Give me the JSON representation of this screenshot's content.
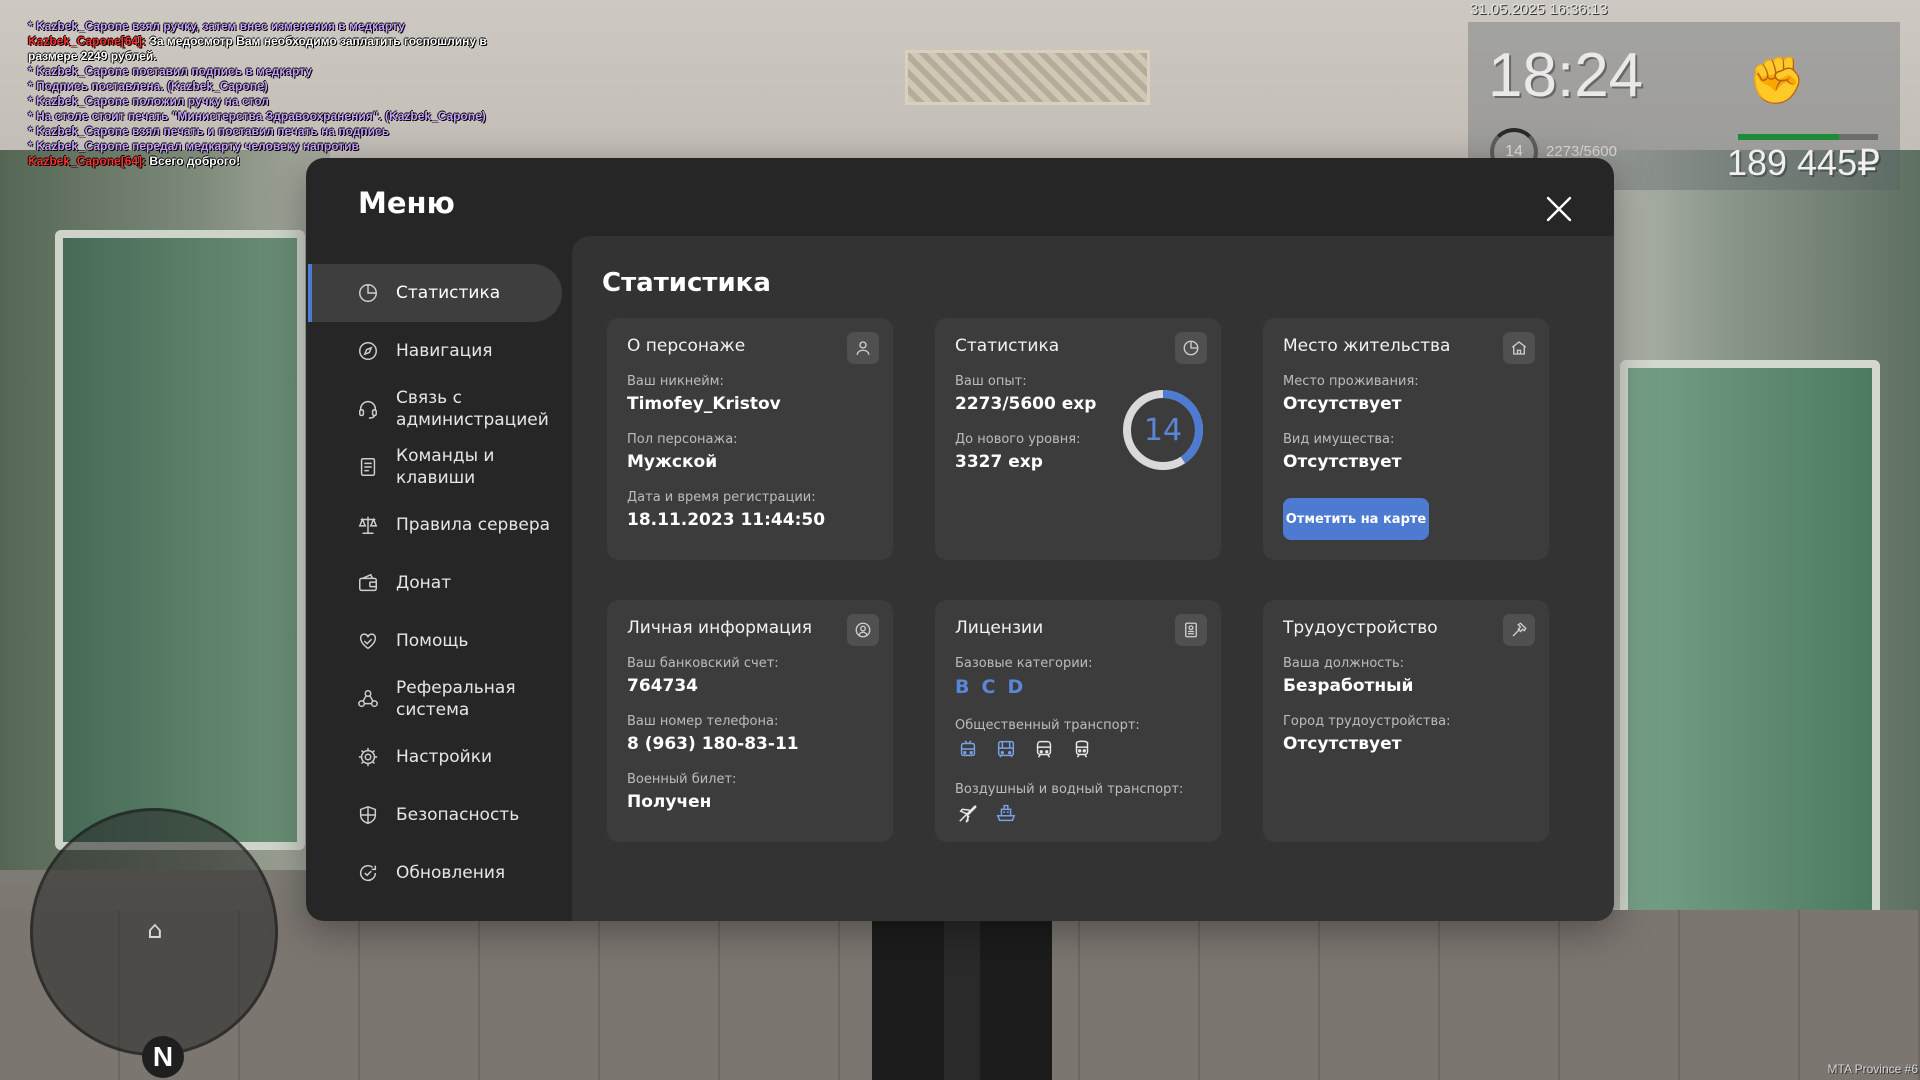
{
  "chat": [
    {
      "type": "me",
      "text": "* Kazbek_Capone взял ручку, затем внес изменения в медкарту"
    },
    {
      "type": "say",
      "nick": "Kazbek_Capone[64]:",
      "text": "За медосмотр Вам необходимо заплатить госпошлину в размере 2249 рублей."
    },
    {
      "type": "me",
      "text": "* Kazbek_Capone поставил подпись в медкарту"
    },
    {
      "type": "me",
      "text": "* Подпись поставлена. (Kazbek_Capone)"
    },
    {
      "type": "me",
      "text": "* Kazbek_Capone положил ручку на стол"
    },
    {
      "type": "me",
      "text": "* На столе стоит печать \"Министерства Здравоохранения\". (Kazbek_Capone)"
    },
    {
      "type": "me",
      "text": "* Kazbek_Capone взял печать и поставил печать на подпись"
    },
    {
      "type": "me",
      "text": "* Kazbek_Capone передал медкарту человеку напротив"
    },
    {
      "type": "say",
      "nick": "Kazbek_Capone[64]:",
      "text": "Всего доброго!"
    }
  ],
  "hud": {
    "datetime": "31.05.2025 16:36:13",
    "time": "18:24",
    "level": "14",
    "exp": "2273/5600",
    "money": "189 445₽",
    "health_fraction": 0.72,
    "health_color": "#1f8a3a",
    "fist_icon": "fist-icon",
    "watermark": "MTA Province #6"
  },
  "radar": {
    "north": "N"
  },
  "menu": {
    "title": "Меню",
    "accent": "#4d7bd1",
    "nav": [
      {
        "id": "stats",
        "label": "Статистика",
        "icon": "pie-chart-icon",
        "active": true
      },
      {
        "id": "navigation",
        "label": "Навигация",
        "icon": "compass-icon"
      },
      {
        "id": "admin",
        "label": "Связь с администрацией",
        "icon": "headset-icon"
      },
      {
        "id": "commands",
        "label": "Команды и клавиши",
        "icon": "document-list-icon"
      },
      {
        "id": "rules",
        "label": "Правила сервера",
        "icon": "scales-icon"
      },
      {
        "id": "donate",
        "label": "Донат",
        "icon": "wallet-icon"
      },
      {
        "id": "help",
        "label": "Помощь",
        "icon": "heart-hands-icon"
      },
      {
        "id": "referral",
        "label": "Реферальная система",
        "icon": "people-network-icon"
      },
      {
        "id": "settings",
        "label": "Настройки",
        "icon": "gear-icon"
      },
      {
        "id": "security",
        "label": "Безопасность",
        "icon": "shield-icon"
      },
      {
        "id": "updates",
        "label": "Обновления",
        "icon": "refresh-check-icon"
      }
    ]
  },
  "content": {
    "title": "Статистика",
    "character": {
      "title": "О персонаже",
      "icon": "user-icon",
      "nick_label": "Ваш никнейм:",
      "nick": "Timofey_Kristov",
      "gender_label": "Пол персонажа:",
      "gender": "Мужской",
      "reg_label": "Дата и время регистрации:",
      "reg": "18.11.2023 11:44:50"
    },
    "stats": {
      "title": "Статистика",
      "icon": "pie-chart-icon",
      "exp_label": "Ваш опыт:",
      "exp": "2273/5600 exp",
      "next_label": "До нового уровня:",
      "next": "3327 exp",
      "level": "14",
      "progress": 0.406,
      "ring_color": "#4d7bd1",
      "ring_track": "#d9d9d9"
    },
    "residence": {
      "title": "Место жительства",
      "icon": "house-icon",
      "place_label": "Место проживания:",
      "place": "Отсутствует",
      "property_label": "Вид имущества:",
      "property": "Отсутствует",
      "button": "Отметить на карте"
    },
    "personal": {
      "title": "Личная информация",
      "icon": "user-circle-icon",
      "bank_label": "Ваш банковский счет:",
      "bank": "764734",
      "phone_label": "Ваш номер телефона:",
      "phone": "8 (963) 180-83-11",
      "military_label": "Военный билет:",
      "military": "Получен"
    },
    "licenses": {
      "title": "Лицензии",
      "icon": "id-card-icon",
      "basic_label": "Базовые категории:",
      "categories": [
        "B",
        "C",
        "D"
      ],
      "public_label": "Общественный транспорт:",
      "public": [
        {
          "icon": "trolleybus-icon",
          "on": true
        },
        {
          "icon": "bus-icon",
          "on": true
        },
        {
          "icon": "tram-icon",
          "on": false
        },
        {
          "icon": "train-icon",
          "on": false
        }
      ],
      "air_label": "Воздушный и водный транспорт:",
      "air": [
        {
          "icon": "plane-icon",
          "on": false
        },
        {
          "icon": "boat-icon",
          "on": true
        }
      ]
    },
    "employment": {
      "title": "Трудоустройство",
      "icon": "hammer-icon",
      "position_label": "Ваша должность:",
      "position": "Безработный",
      "city_label": "Город трудоустройства:",
      "city": "Отсутствует"
    }
  }
}
